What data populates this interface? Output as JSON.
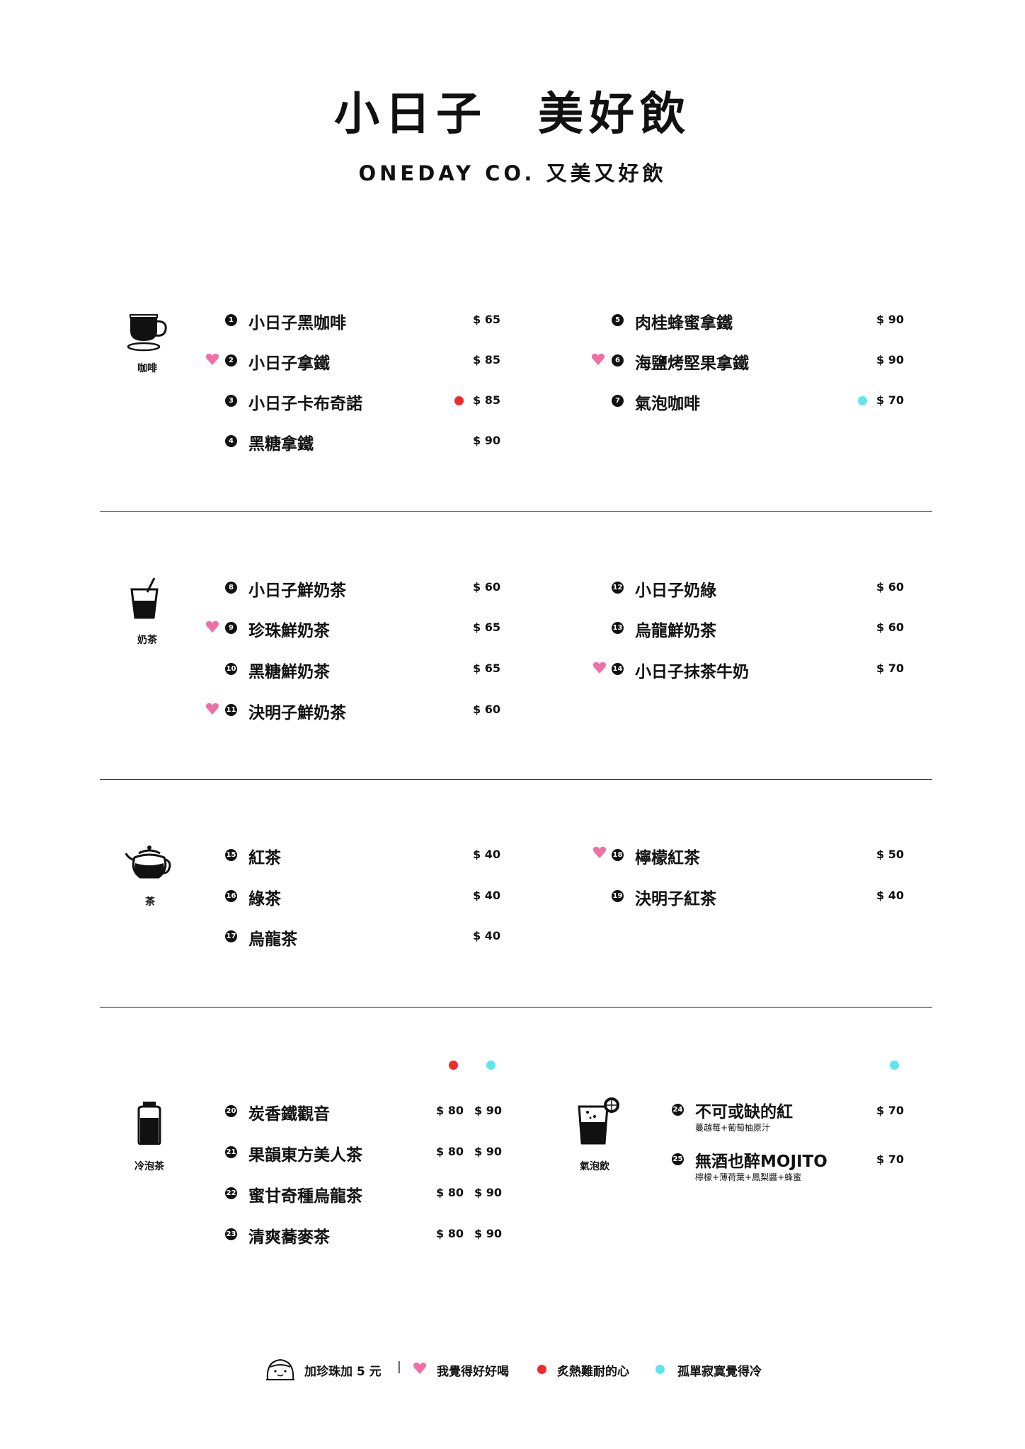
{
  "header": {
    "title": "小日子　美好飲",
    "subtitle": "ONEDAY CO. 又美又好飲"
  },
  "colors": {
    "heart": "#f06fa6",
    "hot": "#ee2b2b",
    "cold": "#5ee6ee",
    "ink": "#111111"
  },
  "categories": {
    "coffee": {
      "label": "咖啡",
      "icon": "coffee-cup-icon"
    },
    "milktea": {
      "label": "奶茶",
      "icon": "milk-tea-cup-icon"
    },
    "tea": {
      "label": "茶",
      "icon": "teapot-icon"
    },
    "coldbrew": {
      "label": "冷泡茶",
      "icon": "bottle-icon"
    },
    "sparkling": {
      "label": "氣泡飲",
      "icon": "sparkling-drink-icon"
    }
  },
  "items": {
    "i1": {
      "num": "1",
      "name": "小日子黑咖啡",
      "price": "$ 65"
    },
    "i2": {
      "num": "2",
      "name": "小日子拿鐵",
      "price": "$ 85"
    },
    "i3": {
      "num": "3",
      "name": "小日子卡布奇諾",
      "price": "$ 85"
    },
    "i4": {
      "num": "4",
      "name": "黑糖拿鐵",
      "price": "$ 90"
    },
    "i5": {
      "num": "5",
      "name": "肉桂蜂蜜拿鐵",
      "price": "$ 90"
    },
    "i6": {
      "num": "6",
      "name": "海鹽烤堅果拿鐵",
      "price": "$ 90"
    },
    "i7": {
      "num": "7",
      "name": "氣泡咖啡",
      "price": "$ 70"
    },
    "i8": {
      "num": "8",
      "name": "小日子鮮奶茶",
      "price": "$ 60"
    },
    "i9": {
      "num": "9",
      "name": "珍珠鮮奶茶",
      "price": "$ 65"
    },
    "i10": {
      "num": "10",
      "name": "黑糖鮮奶茶",
      "price": "$ 65"
    },
    "i11": {
      "num": "11",
      "name": "決明子鮮奶茶",
      "price": "$ 60"
    },
    "i12": {
      "num": "12",
      "name": "小日子奶綠",
      "price": "$ 60"
    },
    "i13": {
      "num": "13",
      "name": "烏龍鮮奶茶",
      "price": "$ 60"
    },
    "i14": {
      "num": "14",
      "name": "小日子抹茶牛奶",
      "price": "$ 70"
    },
    "i15": {
      "num": "15",
      "name": "紅茶",
      "price": "$ 40"
    },
    "i16": {
      "num": "16",
      "name": "綠茶",
      "price": "$ 40"
    },
    "i17": {
      "num": "17",
      "name": "烏龍茶",
      "price": "$ 40"
    },
    "i18": {
      "num": "18",
      "name": "檸檬紅茶",
      "price": "$ 50"
    },
    "i19": {
      "num": "19",
      "name": "決明子紅茶",
      "price": "$ 40"
    },
    "i20": {
      "num": "20",
      "name": "炭香鐵觀音",
      "price_hot": "$ 80",
      "price_cold": "$ 90"
    },
    "i21": {
      "num": "21",
      "name": "果韻東方美人茶",
      "price_hot": "$ 80",
      "price_cold": "$ 90"
    },
    "i22": {
      "num": "22",
      "name": "蜜甘奇種烏龍茶",
      "price_hot": "$ 80",
      "price_cold": "$ 90"
    },
    "i23": {
      "num": "23",
      "name": "清爽蕎麥茶",
      "price_hot": "$ 80",
      "price_cold": "$ 90"
    },
    "i24": {
      "num": "24",
      "name": "不可或缺的紅",
      "desc": "蔓越莓+葡萄柚原汁",
      "price": "$ 70"
    },
    "i25": {
      "num": "25",
      "name": "無酒也醉MOJITO",
      "desc": "檸檬+薄荷葉+鳳梨醬+蜂蜜",
      "price": "$ 70"
    }
  },
  "legend": {
    "pearl": "加珍珠加 5 元",
    "separator": "|",
    "favorite": "我覺得好好喝",
    "hot": "炙熱難耐的心",
    "cold": "孤單寂寞覺得冷"
  }
}
